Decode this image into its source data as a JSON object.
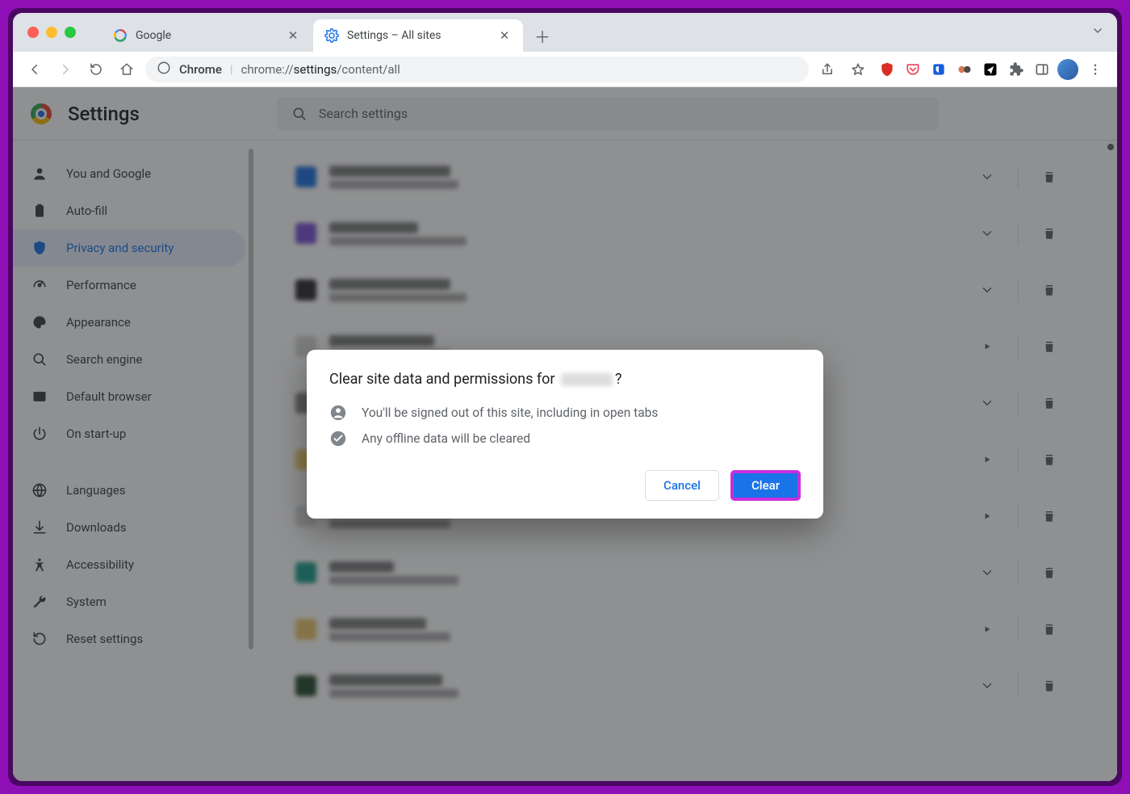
{
  "tabs": [
    {
      "title": "Google",
      "favicon": "google"
    },
    {
      "title": "Settings – All sites",
      "favicon": "gear",
      "active": true
    }
  ],
  "toolbar": {
    "url_display": {
      "scheme": "Chrome",
      "sep": " | ",
      "host": "chrome://",
      "path_strong": "settings",
      "path_rest": "/content/all"
    }
  },
  "page_header": {
    "title": "Settings",
    "search_placeholder": "Search settings"
  },
  "sidebar": {
    "items": [
      {
        "icon": "person",
        "label": "You and Google"
      },
      {
        "icon": "clipboard",
        "label": "Auto-fill"
      },
      {
        "icon": "shield",
        "label": "Privacy and security",
        "active": true
      },
      {
        "icon": "speed",
        "label": "Performance"
      },
      {
        "icon": "palette",
        "label": "Appearance"
      },
      {
        "icon": "search",
        "label": "Search engine"
      },
      {
        "icon": "browser",
        "label": "Default browser"
      },
      {
        "icon": "power",
        "label": "On start-up"
      }
    ],
    "items2": [
      {
        "icon": "globe",
        "label": "Languages"
      },
      {
        "icon": "download",
        "label": "Downloads"
      },
      {
        "icon": "access",
        "label": "Accessibility"
      },
      {
        "icon": "wrench",
        "label": "System"
      },
      {
        "icon": "reset",
        "label": "Reset settings"
      }
    ]
  },
  "sites": [
    {
      "color": "#1b6fe0",
      "w1": 150,
      "w2": 160,
      "arrow": "chevron"
    },
    {
      "color": "#7b4fd6",
      "w1": 110,
      "w2": 170,
      "arrow": "chevron"
    },
    {
      "color": "#2b2b2b",
      "w1": 150,
      "w2": 170,
      "arrow": "chevron"
    },
    {
      "color": "#d5d5d5",
      "w1": 130,
      "w2": 150,
      "arrow": "triangle"
    },
    {
      "color": "#888",
      "w1": 140,
      "w2": 160,
      "arrow": "chevron"
    },
    {
      "color": "#f0d070",
      "w1": 130,
      "w2": 150,
      "arrow": "triangle"
    },
    {
      "color": "#dadada",
      "w1": 150,
      "w2": 150,
      "arrow": "triangle"
    },
    {
      "color": "#1a9c8c",
      "w1": 80,
      "w2": 160,
      "arrow": "chevron"
    },
    {
      "color": "#e8c56a",
      "w1": 120,
      "w2": 150,
      "arrow": "triangle"
    },
    {
      "color": "#274a30",
      "w1": 140,
      "w2": 160,
      "arrow": "chevron"
    }
  ],
  "dialog": {
    "title_pre": "Clear site data and permissions for ",
    "title_post": "?",
    "line1": "You'll be signed out of this site, including in open tabs",
    "line2": "Any offline data will be cleared",
    "cancel_label": "Cancel",
    "clear_label": "Clear"
  }
}
